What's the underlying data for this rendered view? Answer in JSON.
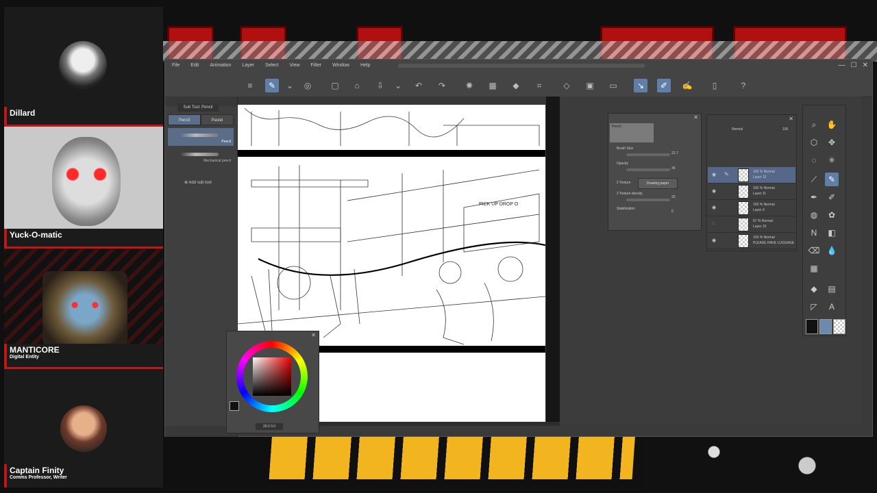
{
  "participants": [
    {
      "name": "Dillard",
      "subtitle": ""
    },
    {
      "name": "Yuck-O-matic",
      "subtitle": ""
    },
    {
      "name": "MANTICORE",
      "subtitle": "Digital Entity"
    },
    {
      "name": "Captain Finity",
      "subtitle": "Comms Professor, Writer"
    }
  ],
  "app": {
    "menu": [
      "File",
      "Edit",
      "Animation",
      "Layer",
      "Select",
      "View",
      "Filter",
      "Window",
      "Help"
    ],
    "window_controls": {
      "minimize": "—",
      "maximize": "☐",
      "close": "✕"
    }
  },
  "tool_property": {
    "subtool_label": "Sub Tool: Pencil",
    "tabs": [
      "Pencil",
      "Pastel"
    ],
    "brushes": [
      {
        "label": "Pencil",
        "selected": true
      },
      {
        "label": "Mechanical pencil",
        "selected": false
      }
    ],
    "add_sub_tool": "Add sub tool"
  },
  "brush_settings": {
    "header": "Pencil",
    "brush_size_label": "Brush Size",
    "brush_size_value": "22.7",
    "opacity_label": "Opacity",
    "opacity_value": "35",
    "texture_label": "2 Texture",
    "texture_button": "Drawing paper",
    "texture_density_label": "2 Texture density",
    "texture_density_value": "33",
    "stabilization_label": "Stabilization",
    "stabilization_value": "0"
  },
  "layers": {
    "blend_mode": "Normal",
    "opacity": "100",
    "items": [
      {
        "line1": "100 % Normal",
        "line2": "Layer 12",
        "selected": true
      },
      {
        "line1": "100 % Normal",
        "line2": "Layer 11",
        "selected": false
      },
      {
        "line1": "100 % Normal",
        "line2": "Layer 3",
        "selected": false
      },
      {
        "line1": "57 % Normal",
        "line2": "Layer 10",
        "selected": false
      },
      {
        "line1": "100 % Normal",
        "line2": "PLEASE HAVE LUGGAGE",
        "selected": false
      }
    ]
  },
  "color_wheel": {
    "field_value": "29.0  0.0",
    "main_color": "#111111",
    "sub_color": "#6b8ab0"
  },
  "canvas_sign_text": "PICK UP  DROP O"
}
